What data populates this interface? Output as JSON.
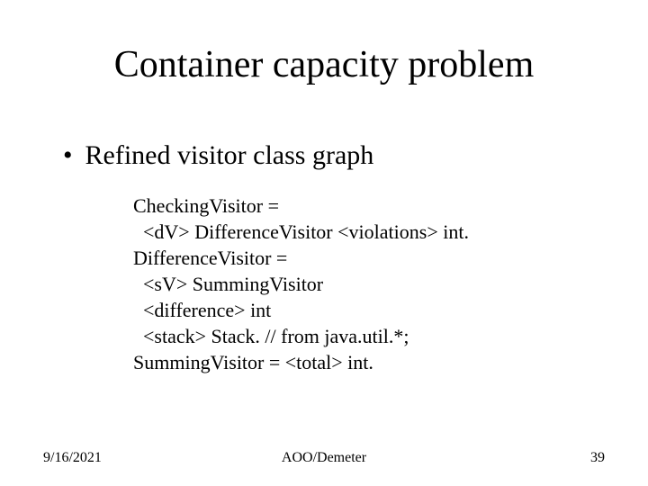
{
  "slide": {
    "title": "Container capacity problem",
    "bullet": "Refined visitor class graph",
    "code": "CheckingVisitor =\n  <dV> DifferenceVisitor <violations> int.\nDifferenceVisitor =\n  <sV> SummingVisitor\n  <difference> int\n  <stack> Stack. // from java.util.*;\nSummingVisitor = <total> int.",
    "footer": {
      "date": "9/16/2021",
      "center": "AOO/Demeter",
      "page": "39"
    }
  }
}
